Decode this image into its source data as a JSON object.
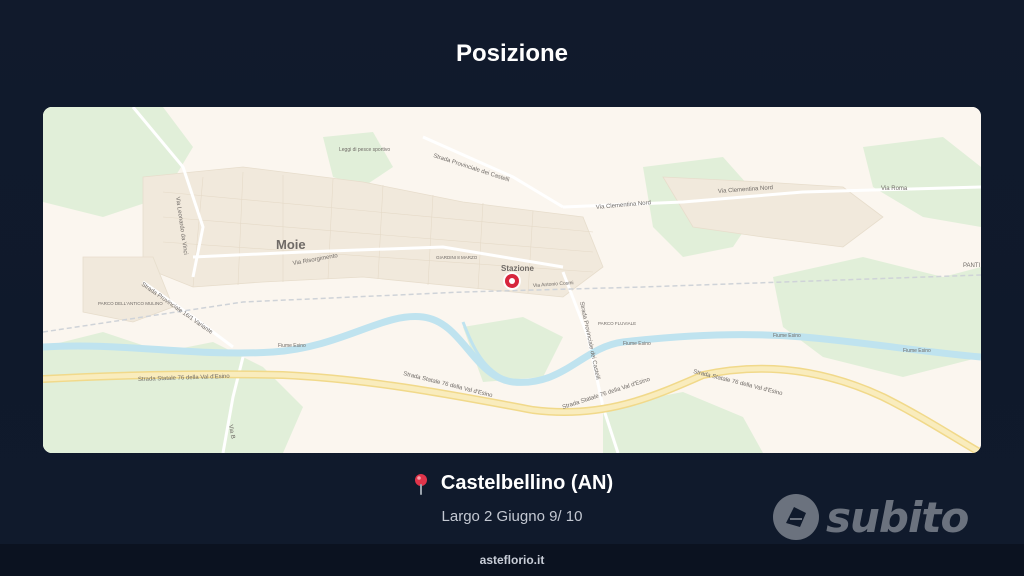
{
  "page": {
    "title": "Posizione"
  },
  "map": {
    "labels": {
      "town": "Moie",
      "station": "Stazione",
      "park_top": "Leggi di pesce sportivo",
      "park_left": "PARCO DELL'ANTICO MULINO",
      "park_fluviale": "PARCO FLUVIALE",
      "giardini": "GIARDINI 8 MARZO",
      "pantiere": "PANTI",
      "roads": {
        "provinciale_castelli": "Strada Provinciale dei Castelli",
        "clementina_nord_1": "Via Clementina Nord",
        "clementina_nord_2": "Via Clementina Nord",
        "via_roma": "Via Roma",
        "leonardo": "Via Leonardo da Vinci",
        "risorgimento": "Via Risorgimento",
        "cesare": "Via Antonio Cosmi",
        "sp_variante": "Strada Provinciale 16/1 Variante",
        "sp_castelli_vert": "Strada Provinciale dei Castelli",
        "ss76_1": "Strada Statale 76 della Val d'Esino",
        "ss76_2": "Strada Statale 76 della Val d'Esino",
        "ss76_3": "Strada Statale 76 della Val d'Esino",
        "ss76_4": "Strada Statale 76 della Val d'Esino",
        "fiume_esino_1": "Fiume Esino",
        "fiume_esino_2": "Fiume Esino",
        "fiume_esino_3": "Fiume Esino",
        "fiume_esino_4": "Fiume Esino",
        "via_bottom": "Via B"
      }
    },
    "colors": {
      "land": "#fbf6ef",
      "green": "#dcefd4",
      "water": "#bfe3ef",
      "highway": "#f8e7a6",
      "marker": "#d7263d"
    }
  },
  "location": {
    "icon": "map-pin-icon",
    "name": "Castelbellino (AN)",
    "address": "Largo 2 Giugno 9/ 10"
  },
  "watermark": {
    "brand": "subito"
  },
  "footer": {
    "site": "asteflorio.it"
  }
}
